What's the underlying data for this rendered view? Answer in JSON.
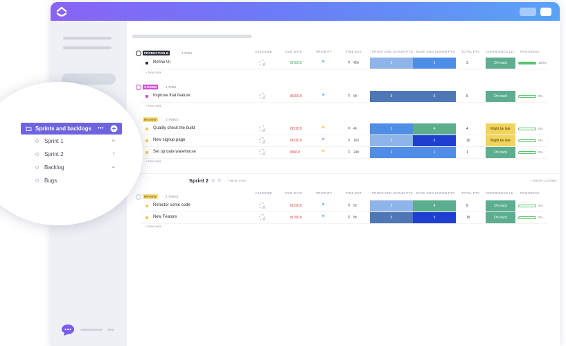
{
  "list_sections": [
    {
      "status": "PRODUCTION",
      "status_color": "#2b2f3a",
      "count": "1 TASK",
      "tasks": [
        {
          "name": "Refine UI",
          "due": "8/16/19",
          "due_color": "#2e9e4d",
          "priority_color": "#7fb2f0",
          "time": "40h",
          "fe": "2",
          "be": "1",
          "fe_color": "#8fb4ea",
          "be_color": "#4f8ee6",
          "total": "3",
          "confidence": "On track",
          "conf_bg": "#5cae8f",
          "conf_fg": "#ffffff",
          "progress": 1.0,
          "progress_text": "100%"
        }
      ]
    },
    {
      "status": "STAGED",
      "status_color": "#d04fd1",
      "count": "1 TASK",
      "tasks": [
        {
          "name": "Improve that feature",
          "due": "8/20/19",
          "due_color": "#d9413a",
          "priority_color": "#7fb2f0",
          "time": "9h",
          "fe": "3",
          "be": "3",
          "fe_color": "#5077b5",
          "be_color": "#5077b5",
          "total": "6",
          "confidence": "On track",
          "conf_bg": "#5cae8f",
          "conf_fg": "#ffffff",
          "progress": 0,
          "progress_text": "0%"
        }
      ]
    },
    {
      "status": "REVIEW",
      "status_color": "#f2c94c",
      "count": "3 TASKS",
      "tasks": [
        {
          "name": "Quality check the build",
          "due": "8/31/19",
          "due_color": "#d9413a",
          "priority_color": "#f2c94c",
          "time": "4h",
          "fe": "1",
          "be": "4",
          "fe_color": "#4f8ee6",
          "be_color": "#5cae8f",
          "total": "4",
          "confidence": "Might be late",
          "conf_bg": "#f2d45c",
          "conf_fg": "#4a3b00",
          "progress": 0,
          "progress_text": "0%"
        },
        {
          "name": "New signup page",
          "due": "8/23/19",
          "due_color": "#d9413a",
          "priority_color": "#7fb2f0",
          "time": "16h",
          "fe": "2",
          "be": "5",
          "fe_color": "#8fb4ea",
          "be_color": "#1e3fd1",
          "total": "10",
          "confidence": "Might be late",
          "conf_bg": "#f2d45c",
          "conf_fg": "#4a3b00",
          "progress": 0,
          "progress_text": "0%"
        },
        {
          "name": "Set up data warehouse",
          "due": "8/8/19",
          "due_color": "#d9413a",
          "priority_color": "#f2c94c",
          "time": "24h",
          "fe": "1",
          "be": "1",
          "fe_color": "#4f8ee6",
          "be_color": "#4f8ee6",
          "total": "1",
          "confidence": "On track",
          "conf_bg": "#5cae8f",
          "conf_fg": "#ffffff",
          "progress": 0,
          "progress_text": "0%"
        }
      ]
    }
  ],
  "sprint2": {
    "title": "Sprint 2",
    "new_task": "+ NEW TASK",
    "show_closed": "+ SHOW CLOSED",
    "status": "REVIEW",
    "status_color": "#f2c94c",
    "count": "2 TASKS",
    "tasks": [
      {
        "name": "Refactor some code",
        "due": "8/23/19",
        "due_color": "#d9413a",
        "priority_color": "#7fb2f0",
        "time": "5h",
        "fe": "2",
        "be": "4",
        "fe_color": "#8fb4ea",
        "be_color": "#5cae8f",
        "total": "6",
        "confidence": "On track",
        "conf_bg": "#5cae8f",
        "conf_fg": "#ffffff",
        "progress": 0,
        "progress_text": "0%"
      },
      {
        "name": "New Feature",
        "due": "8/19/19",
        "due_color": "#d9413a",
        "priority_color": "#7fb2f0",
        "time": "8h",
        "fe": "3",
        "be": "5",
        "fe_color": "#5077b5",
        "be_color": "#1e3fd1",
        "total": "15",
        "confidence": "On track",
        "conf_bg": "#5cae8f",
        "conf_fg": "#ffffff",
        "progress": 0,
        "progress_text": "0%"
      }
    ]
  },
  "columns": [
    "ASSIGNEE",
    "DUE DATE",
    "PRIORITY",
    "TIME EST.",
    "FRONT END SCRUM PTS",
    "BACK END SCRUM PTS",
    "TOTAL PTS",
    "CONFIDENCE LE...",
    "PROGRESS"
  ],
  "new_task_label": "+ New task",
  "sidebar_popup": {
    "selected": "Sprints and backlogs",
    "more": "•••",
    "items": [
      {
        "label": "Sprint 1",
        "count": "5"
      },
      {
        "label": "Sprint 2",
        "count": "7"
      },
      {
        "label": "Backlog",
        "count": "4"
      },
      {
        "label": "Bugs",
        "count": ""
      }
    ]
  },
  "colors": {
    "accent": "#6f64e0",
    "topbar_start": "#8a63f5",
    "topbar_end": "#5aa3f7"
  }
}
